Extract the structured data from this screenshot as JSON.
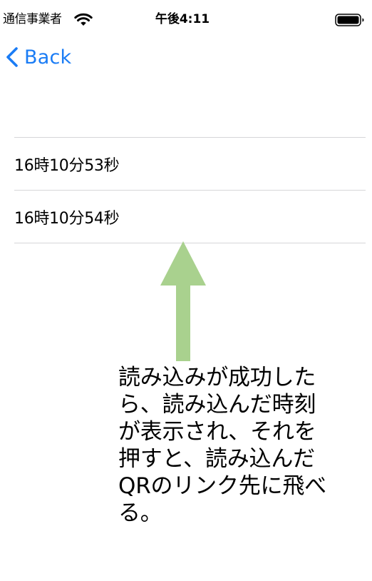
{
  "status_bar": {
    "carrier": "通信事業者",
    "time": "午後4:11"
  },
  "nav": {
    "back_label": "Back",
    "accent_color": "#1a7cf5"
  },
  "history": {
    "items": [
      {
        "label": "16時10分53秒"
      },
      {
        "label": "16時10分54秒"
      }
    ]
  },
  "annotation": {
    "text": "読み込みが成功したら、読み込んだ時刻が表示され、それを押すと、読み込んだQRのリンク先に飛べる。",
    "arrow_color": "#a9d18e",
    "arrow_icon": "up-arrow-icon"
  }
}
